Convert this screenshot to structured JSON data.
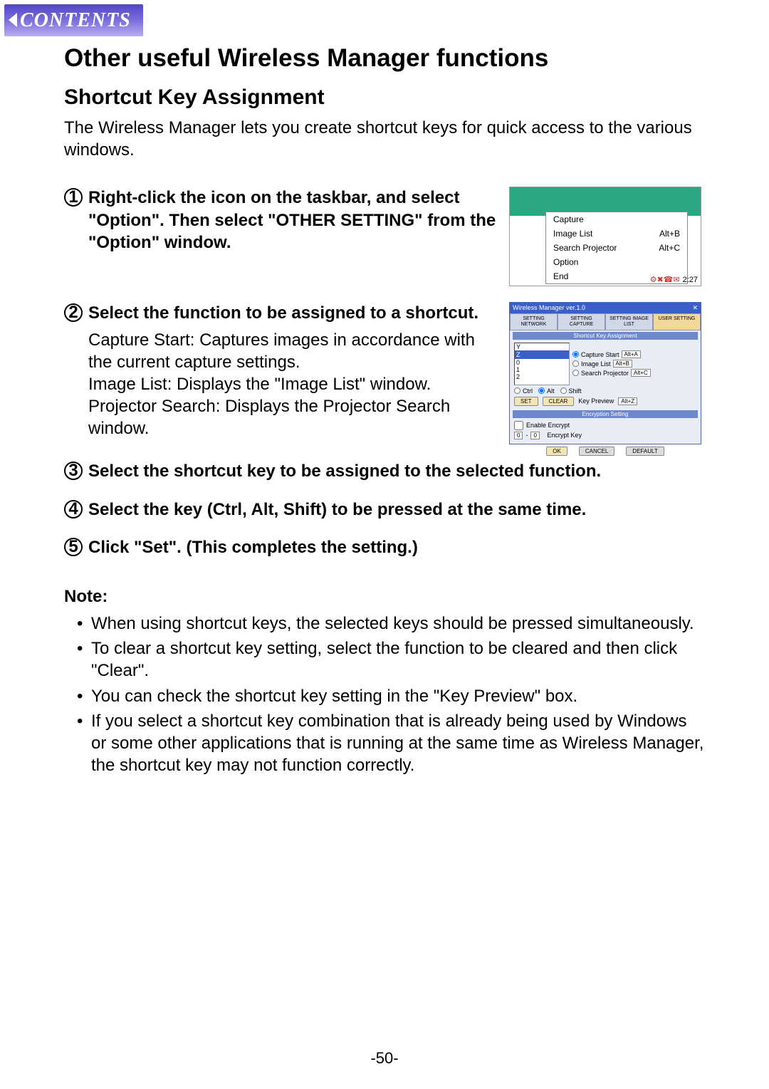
{
  "contents_label": "CONTENTS",
  "title": "Other useful Wireless Manager functions",
  "subtitle": "Shortcut Key Assignment",
  "intro": "The Wireless Manager lets you create shortcut keys for quick access to the various windows.",
  "steps": [
    {
      "num": "1",
      "title": "Right-click the icon on the taskbar, and select \"Option\". Then select \"OTHER SETTING\" from the \"Option\" window."
    },
    {
      "num": "2",
      "title": "Select the function to be assigned to a shortcut.",
      "body": {
        "capture": "Capture Start: Captures images in accordance with the current capture settings.",
        "imagelist": "Image List: Displays the \"Image List\" window.",
        "search": "Projector Search: Displays the Projector Search window."
      }
    },
    {
      "num": "3",
      "title": "Select the shortcut key to be assigned to the selected function."
    },
    {
      "num": "4",
      "title": "Select the key (Ctrl, Alt, Shift) to be pressed at the same time."
    },
    {
      "num": "5",
      "title": "Click \"Set\". (This completes the setting.)"
    }
  ],
  "context_menu": {
    "items": [
      {
        "label": "Capture",
        "accel": ""
      },
      {
        "label": "Image List",
        "accel": "Alt+B"
      },
      {
        "label": "Search Projector",
        "accel": "Alt+C"
      },
      {
        "label": "Option",
        "accel": ""
      },
      {
        "label": "End",
        "accel": ""
      }
    ],
    "clock": "2:27"
  },
  "dialog": {
    "title": "Wireless Manager ver.1.0",
    "tabs": [
      "SETTING NETWORK",
      "SETTING CAPTURE",
      "SETTING IMAGE LIST",
      "USER SETTING"
    ],
    "section_label": "Shortcut Key Assignment",
    "list_items": [
      "Y",
      "Z",
      "0",
      "1",
      "2"
    ],
    "functions": [
      {
        "label": "Capture Start",
        "key": "Alt+A"
      },
      {
        "label": "Image List",
        "key": "Alt+B"
      },
      {
        "label": "Search Projector",
        "key": "Alt+C"
      }
    ],
    "modifiers": [
      "Ctrl",
      "Alt",
      "Shift"
    ],
    "set_label": "SET",
    "clear_label": "CLEAR",
    "keypreview_label": "Key Preview",
    "keypreview_value": "Alt+Z",
    "encryption_label": "Encryption Setting",
    "enable_encrypt": "Enable Encrypt",
    "encrypt_key_label": "Encrypt Key",
    "encrypt_a": "0",
    "encrypt_b": "0",
    "ok": "OK",
    "cancel": "CANCEL",
    "default": "DEFAULT"
  },
  "notes_title": "Note:",
  "notes": [
    "When using shortcut keys, the selected keys should be pressed simultaneously.",
    "To clear a shortcut key setting, select the function to be cleared and then click \"Clear\".",
    "You can check the shortcut key setting in the \"Key Preview\" box.",
    "If you select a shortcut key combination that is already being used by Windows or some other applications that is running at the same time as Wireless Manager, the shortcut key may not function correctly."
  ],
  "page_number": "-50-"
}
